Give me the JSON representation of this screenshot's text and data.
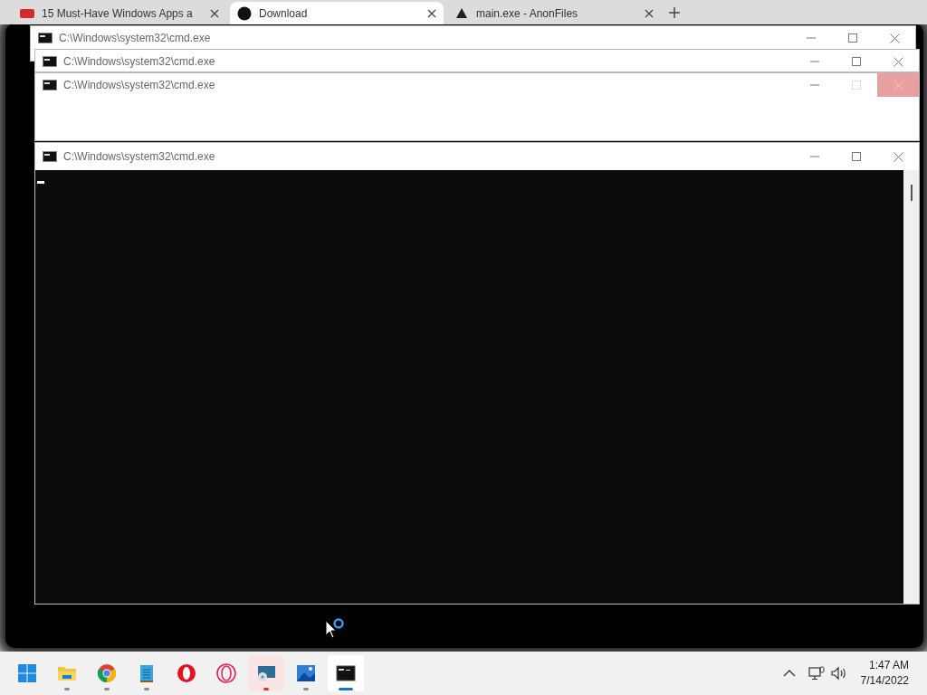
{
  "browser_tabs": [
    {
      "title": "15 Must-Have Windows Apps a",
      "selected": false,
      "kind": "news"
    },
    {
      "title": "Download",
      "selected": true,
      "kind": "dot"
    },
    {
      "title": "main.exe - AnonFiles",
      "selected": false,
      "kind": "anon"
    }
  ],
  "windows": [
    {
      "title": "C:\\Windows\\system32\\cmd.exe",
      "close_hovered": false
    },
    {
      "title": "C:\\Windows\\system32\\cmd.exe",
      "close_hovered": false
    },
    {
      "title": "C:\\Windows\\system32\\cmd.exe",
      "close_hovered": true
    },
    {
      "title": "C:\\Windows\\system32\\cmd.exe",
      "close_hovered": false
    }
  ],
  "taskbar": {
    "apps": [
      {
        "kind": "start",
        "running": false,
        "attention": false,
        "selected": false
      },
      {
        "kind": "folder",
        "running": true,
        "attention": false,
        "selected": false
      },
      {
        "kind": "chrome",
        "running": true,
        "attention": false,
        "selected": false
      },
      {
        "kind": "notepad",
        "running": true,
        "attention": false,
        "selected": false
      },
      {
        "kind": "opera",
        "running": false,
        "attention": false,
        "selected": false
      },
      {
        "kind": "opera-gx",
        "running": false,
        "attention": false,
        "selected": false
      },
      {
        "kind": "remote",
        "running": true,
        "attention": true,
        "selected": false
      },
      {
        "kind": "photos",
        "running": true,
        "attention": false,
        "selected": false
      },
      {
        "kind": "terminal",
        "running": true,
        "attention": false,
        "selected": true
      }
    ],
    "clock": {
      "time": "1:47 AM",
      "date": "7/14/2022"
    }
  }
}
